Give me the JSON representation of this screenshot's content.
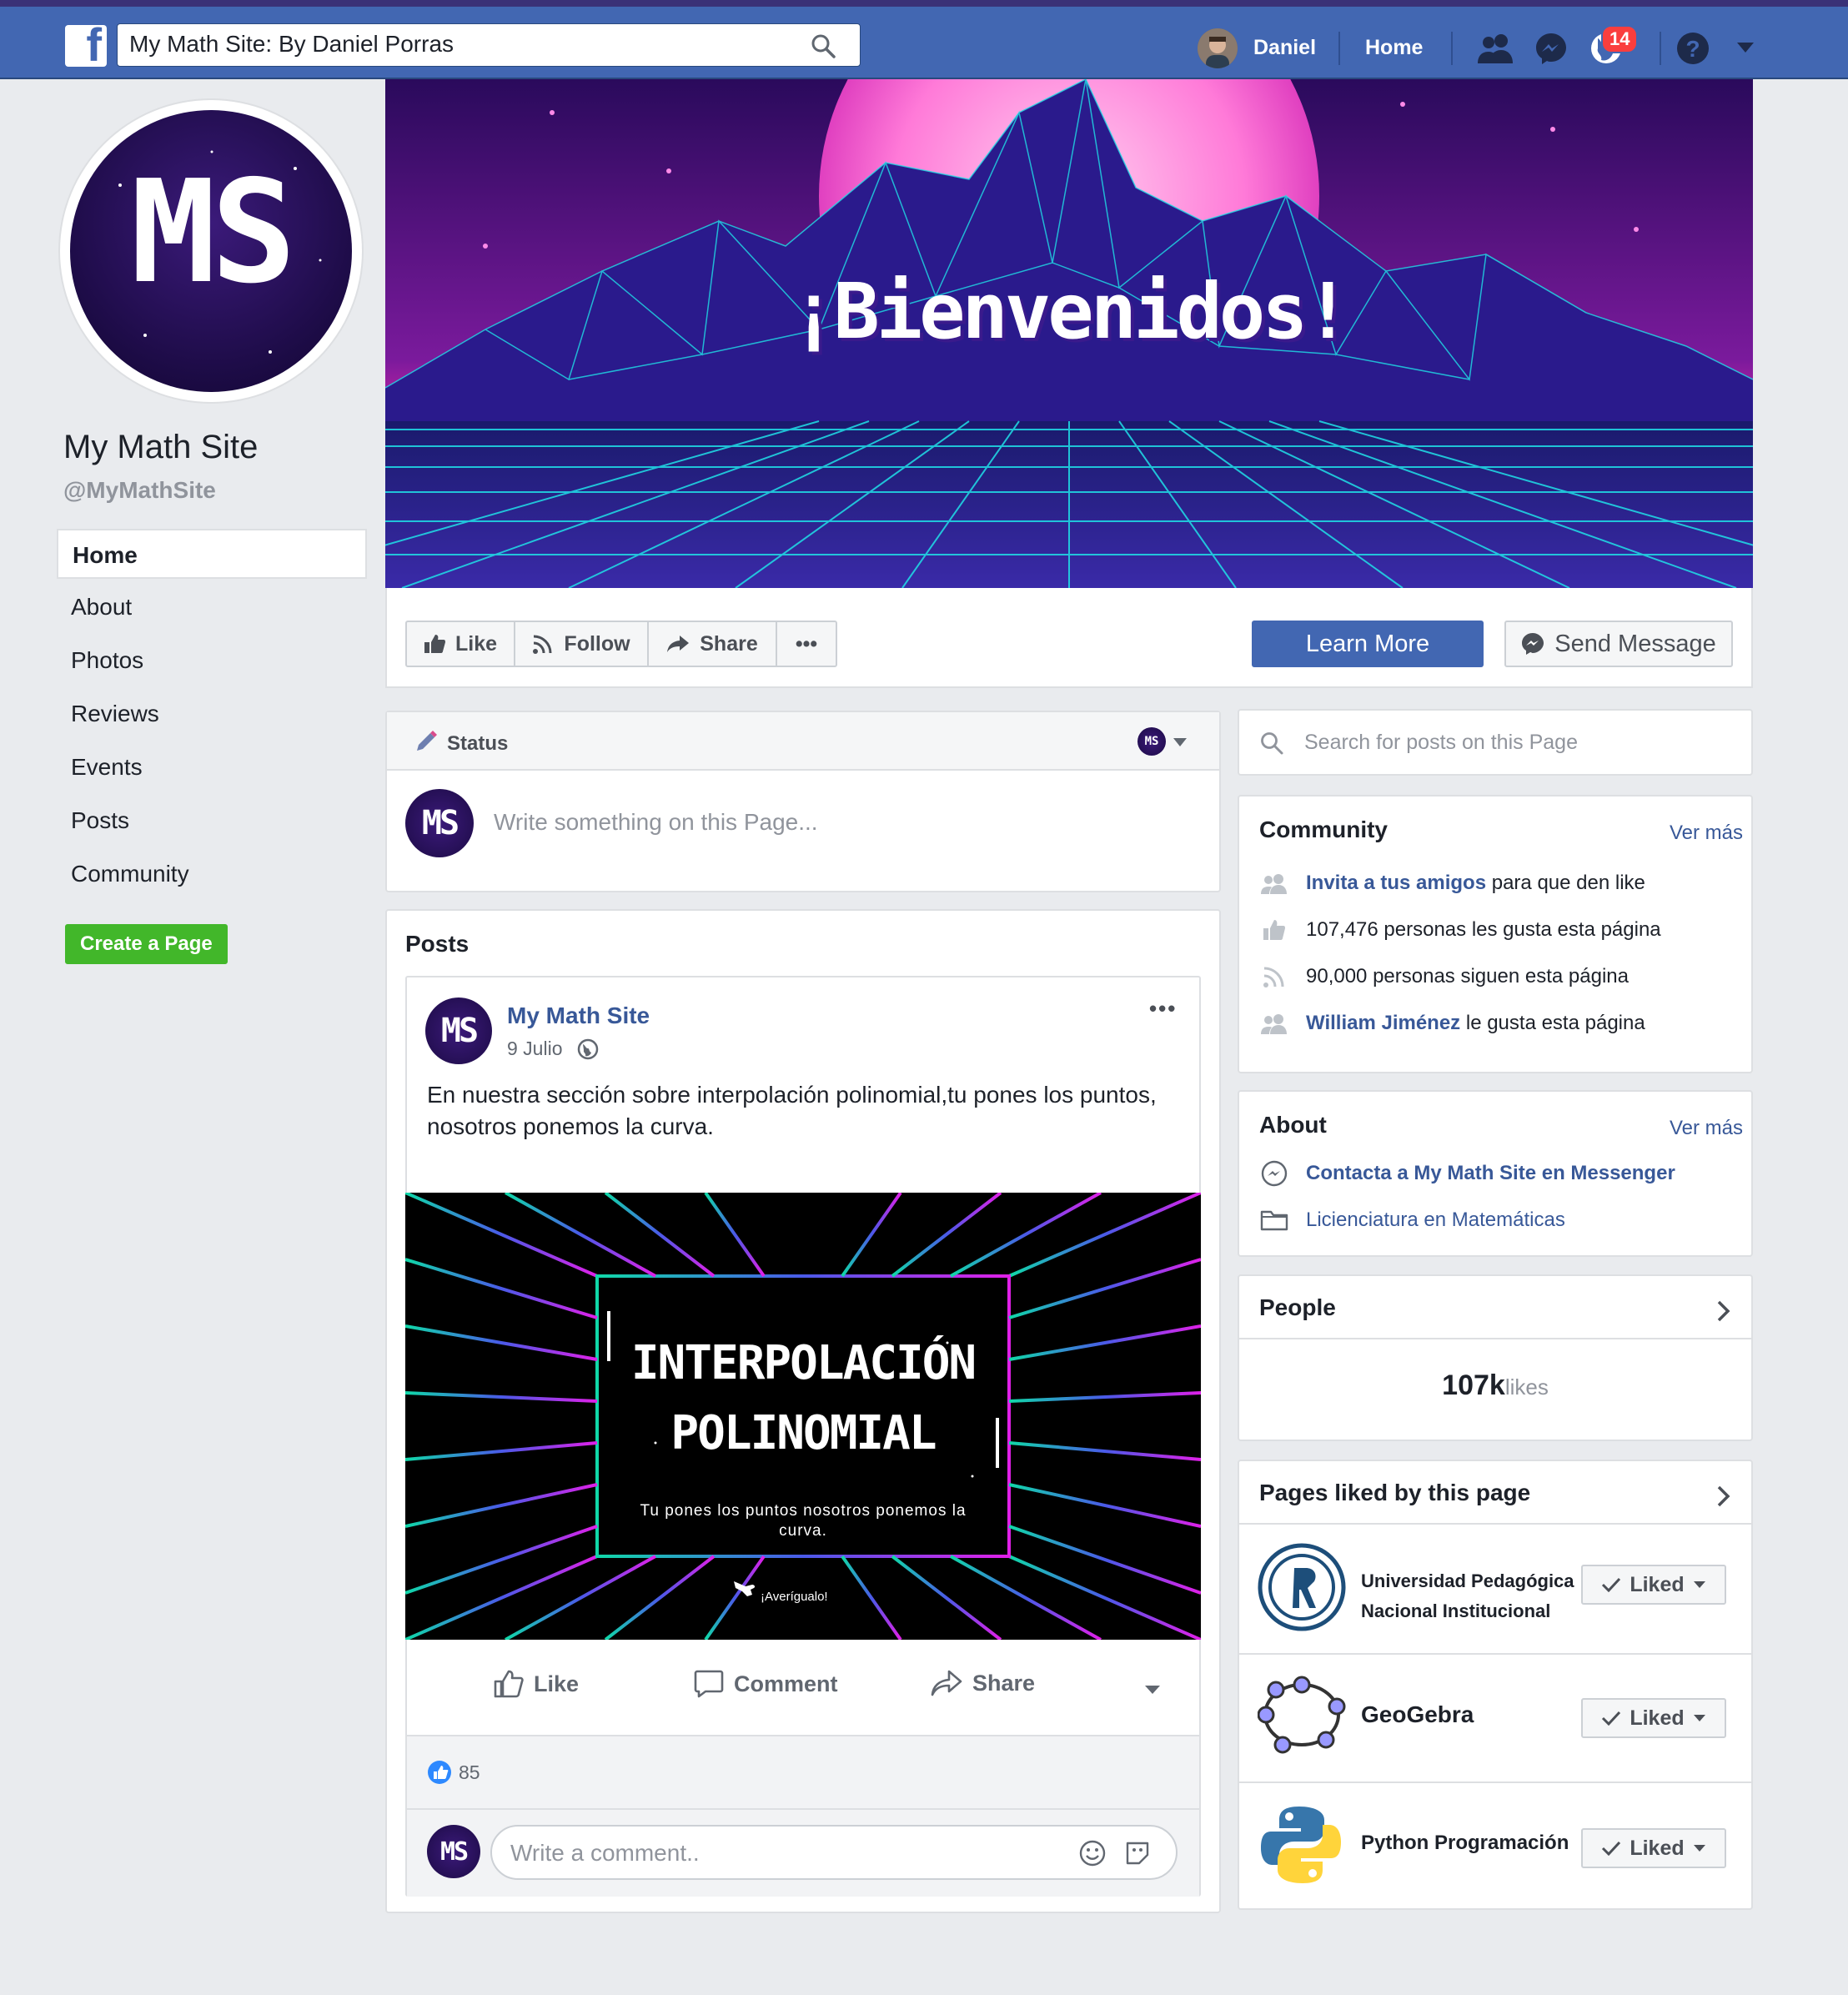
{
  "topbar": {
    "search_value": "My Math Site: By Daniel Porras",
    "user_name": "Daniel",
    "home_label": "Home",
    "notifications_count": "14"
  },
  "profile": {
    "logo_text": "MS",
    "name": "My Math Site",
    "handle": "@MyMathSite"
  },
  "sidebar": {
    "items": [
      {
        "label": "Home",
        "active": true
      },
      {
        "label": "About"
      },
      {
        "label": "Photos"
      },
      {
        "label": "Reviews"
      },
      {
        "label": "Events"
      },
      {
        "label": "Posts"
      },
      {
        "label": "Community"
      }
    ],
    "create_page": "Create a Page"
  },
  "cover": {
    "title": "¡Bienvenidos!"
  },
  "actions": {
    "like": "Like",
    "follow": "Follow",
    "share": "Share",
    "more": "•••",
    "learn_more": "Learn More",
    "send_message": "Send Message"
  },
  "composer": {
    "status_label": "Status",
    "placeholder": "Write something on this Page..."
  },
  "posts": {
    "header": "Posts",
    "post": {
      "author": "My Math Site",
      "date": "9 Julio",
      "text_line1": "En nuestra sección sobre interpolación polinomial,tu pones los puntos,",
      "text_line2": "nosotros ponemos la curva.",
      "image_title_1": "INTERPOLACIÓN",
      "image_title_2": "POLINOMIAL",
      "image_subtitle_1": "Tu pones los puntos nosotros ponemos la",
      "image_subtitle_2": "curva.",
      "image_cta": "¡Averígualo!",
      "like": "Like",
      "comment": "Comment",
      "share": "Share",
      "reactions_count": "85",
      "comment_placeholder": "Write a comment.."
    }
  },
  "right": {
    "search_placeholder": "Search for posts on this Page",
    "community": {
      "title": "Community",
      "see_more": "Ver más",
      "invite_link": "Invita a tus amigos",
      "invite_rest": "para que den like",
      "likes_text": "107,476 personas les gusta esta página",
      "follows_text": "90,000 personas siguen esta página",
      "friend_link": "William Jiménez",
      "friend_rest": "le gusta esta página"
    },
    "about": {
      "title": "About",
      "see_more": "Ver más",
      "messenger_link": "Contacta a My Math Site en Messenger",
      "category": "Licienciatura en Matemáticas"
    },
    "people": {
      "title": "People",
      "count": "107k",
      "count_label": "likes"
    },
    "pages_liked": {
      "title": "Pages liked by this page",
      "liked_label": "Liked",
      "items": [
        {
          "name_line1": "Universidad Pedagógica",
          "name_line2": "Nacional Institucional"
        },
        {
          "name_line1": "GeoGebra",
          "name_line2": ""
        },
        {
          "name_line1": "Python Programación",
          "name_line2": ""
        }
      ]
    }
  },
  "colors": {
    "fb_blue": "#4267b2",
    "link_blue": "#385898",
    "green": "#42b72a",
    "badge_red": "#fa3e3e"
  }
}
